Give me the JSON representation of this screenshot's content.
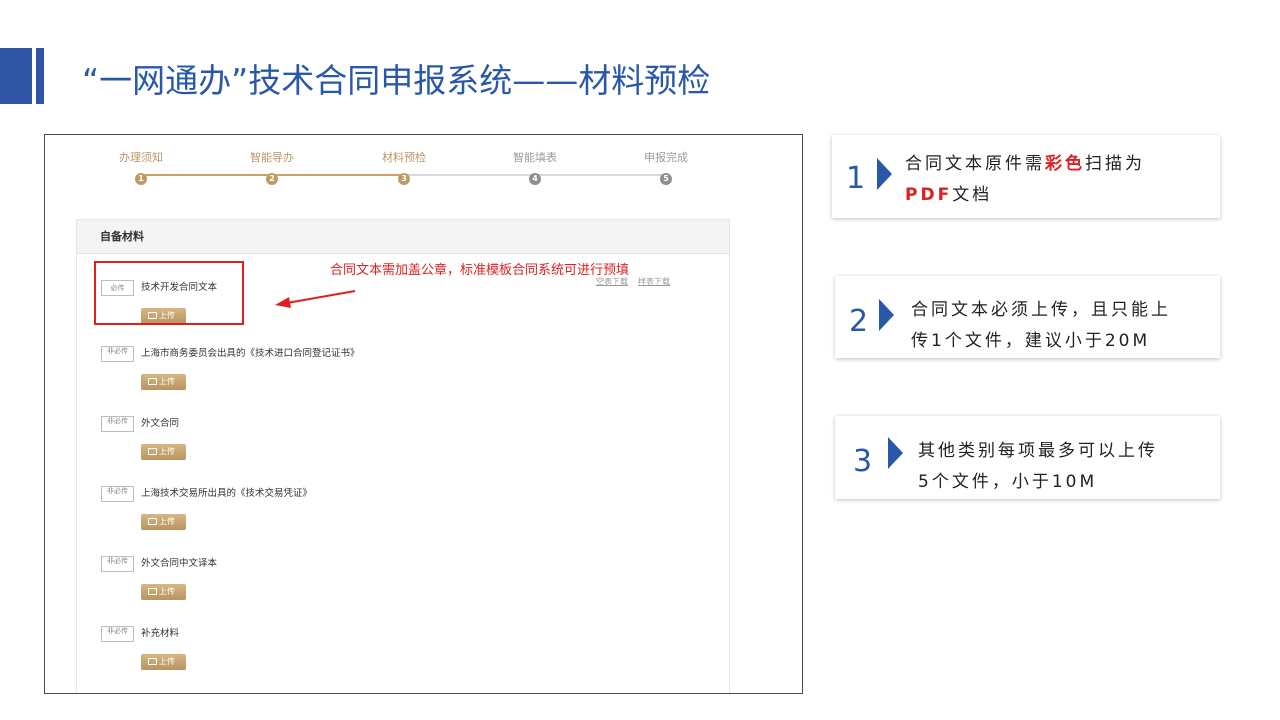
{
  "slide": {
    "title": "“一网通办”技术合同申报系统——材料预检"
  },
  "app": {
    "steps": [
      {
        "label": "办理须知",
        "num": "1",
        "state": "done"
      },
      {
        "label": "智能导办",
        "num": "2",
        "state": "done"
      },
      {
        "label": "材料预检",
        "num": "3",
        "state": "current"
      },
      {
        "label": "智能填表",
        "num": "4",
        "state": "todo"
      },
      {
        "label": "申报完成",
        "num": "5",
        "state": "todo"
      }
    ],
    "panel_title": "自备材料",
    "upload_label": "上传",
    "materials": [
      {
        "tag": "必传",
        "name": "技术开发合同文本"
      },
      {
        "tag": "非必传",
        "name": "上海市商务委员会出具的《技术进口合同登记证书》"
      },
      {
        "tag": "非必传",
        "name": "外文合同"
      },
      {
        "tag": "非必传",
        "name": "上海技术交易所出具的《技术交易凭证》"
      },
      {
        "tag": "非必传",
        "name": "外文合同中文译本"
      },
      {
        "tag": "非必传",
        "name": "补充材料"
      }
    ],
    "download_links": [
      "空表下载",
      "样表下载"
    ],
    "annotation": "合同文本需加盖公章，标准模板合同系统可进行预填"
  },
  "notes": [
    {
      "num": "1",
      "line1_a": "合同文本原件需",
      "line1_red": "彩色",
      "line1_b": "扫描为",
      "line2_red": "PDF",
      "line2_b": "文档"
    },
    {
      "num": "2",
      "line1": "合同文本必须上传，且只能上",
      "line2": "传1个文件，建议小于20M"
    },
    {
      "num": "3",
      "line1": "其他类别每项最多可以上传",
      "line2": "5个文件，小于10M"
    }
  ],
  "colors": {
    "accent_blue": "#2a58a8",
    "gold": "#c9a46a",
    "red": "#e02020"
  }
}
